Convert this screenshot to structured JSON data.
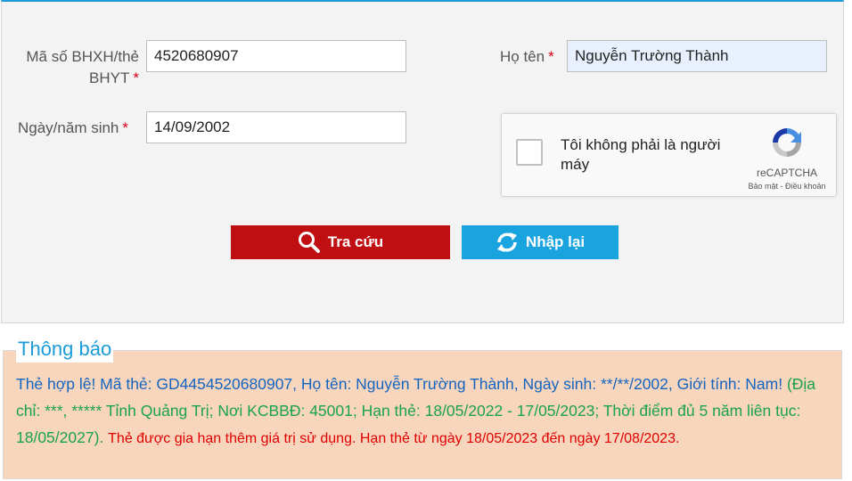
{
  "form": {
    "bhxh_label_line1": "Mã số BHXH/thẻ",
    "bhxh_label_line2": "BHYT",
    "bhxh_value": "4520680907",
    "name_label": "Họ tên",
    "name_value": "Nguyễn Trường Thành",
    "dob_label": "Ngày/năm sinh",
    "dob_value": "14/09/2002",
    "required_mark": "*"
  },
  "recaptcha": {
    "text_line1": "Tôi không phải là người",
    "text_line2": "máy",
    "brand": "reCAPTCHA",
    "privacy": "Bảo mật",
    "separator": " - ",
    "terms": "Điều khoản"
  },
  "buttons": {
    "search_label": "Tra cứu",
    "reset_label": "Nhập lại"
  },
  "notice": {
    "title": "Thông báo",
    "part_blue": "Thẻ hợp lệ! Mã thẻ: GD4454520680907, Họ tên: Nguyễn Trường Thành, Ngày sinh: **/**/2002, Giới tính: Nam! ",
    "part_green": "(Địa chỉ: ***, ***** Tỉnh Quảng Trị; Nơi KCBBĐ: 45001; Hạn thẻ: 18/05/2022 - 17/05/2023; Thời điểm đủ 5 năm liên tục: 18/05/2027). ",
    "part_red": "Thẻ được gia hạn thêm giá trị sử dụng. Hạn thẻ từ ngày 18/05/2023 đến ngày 17/08/2023."
  },
  "colors": {
    "accent": "#1b9bd7",
    "search_button": "#c00f12",
    "reset_button": "#1aa4df",
    "notice_bg": "#f8d5bd",
    "status_valid": "#1565c0",
    "status_details": "#1aa34a",
    "status_extension": "#e00000"
  }
}
